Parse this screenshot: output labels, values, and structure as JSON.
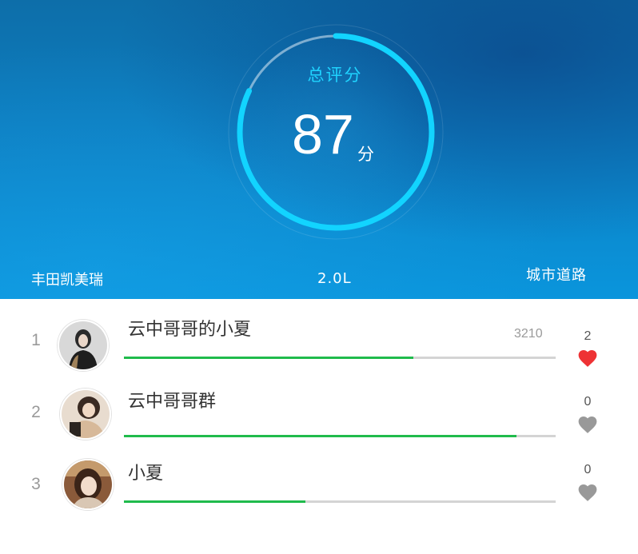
{
  "summary": {
    "title": "总评分",
    "score": "87",
    "unit": "分",
    "ring_progress": 0.82,
    "car_model": "丰田凯美瑞",
    "engine": "2.0L",
    "road_type": "城市道路"
  },
  "ranking": [
    {
      "rank": "1",
      "name": "云中哥哥的小夏",
      "score": "3210",
      "progress": 0.67,
      "likes": "2",
      "liked": true,
      "heart_color": "#ee3234"
    },
    {
      "rank": "2",
      "name": "云中哥哥群",
      "score": "",
      "progress": 0.91,
      "likes": "0",
      "liked": false,
      "heart_color": "#999999"
    },
    {
      "rank": "3",
      "name": "小夏",
      "score": "",
      "progress": 0.42,
      "likes": "0",
      "liked": false,
      "heart_color": "#999999"
    }
  ],
  "colors": {
    "accent_cyan": "#1fd3ff",
    "progress_green": "#20bb4c",
    "track_gray": "#d4d4d4"
  }
}
